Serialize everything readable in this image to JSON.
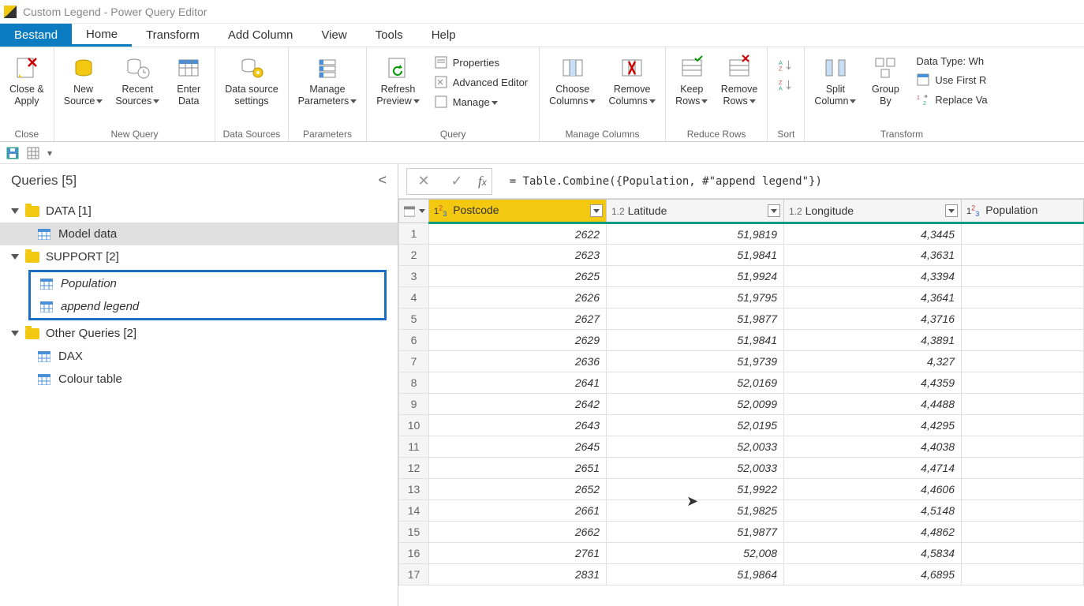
{
  "titlebar": {
    "text": "Custom Legend - Power Query Editor"
  },
  "menu": {
    "file": "Bestand",
    "home": "Home",
    "transform": "Transform",
    "addcolumn": "Add Column",
    "view": "View",
    "tools": "Tools",
    "help": "Help"
  },
  "ribbon": {
    "close": {
      "closeapply": "Close &\nApply",
      "group": "Close"
    },
    "newquery": {
      "newsource": "New\nSource",
      "recentsources": "Recent\nSources",
      "enterdata": "Enter\nData",
      "group": "New Query"
    },
    "datasources": {
      "settings": "Data source\nsettings",
      "group": "Data Sources"
    },
    "parameters": {
      "manage": "Manage\nParameters",
      "group": "Parameters"
    },
    "query": {
      "refresh": "Refresh\nPreview",
      "properties": "Properties",
      "advanced": "Advanced Editor",
      "manage": "Manage",
      "group": "Query"
    },
    "managecols": {
      "choose": "Choose\nColumns",
      "remove": "Remove\nColumns",
      "group": "Manage Columns"
    },
    "reducerows": {
      "keep": "Keep\nRows",
      "remove": "Remove\nRows",
      "group": "Reduce Rows"
    },
    "sort": {
      "group": "Sort"
    },
    "transform": {
      "split": "Split\nColumn",
      "groupby": "Group\nBy",
      "datatype": "Data Type: Wh",
      "firstrow": "Use First R",
      "replace": "Replace Va",
      "group": "Transform"
    }
  },
  "queries": {
    "header": "Queries [5]",
    "folders": {
      "data": {
        "label": "DATA [1]",
        "items": [
          {
            "label": "Model data"
          }
        ]
      },
      "support": {
        "label": "SUPPORT [2]",
        "items": [
          {
            "label": "Population"
          },
          {
            "label": "append legend"
          }
        ]
      },
      "other": {
        "label": "Other Queries [2]",
        "items": [
          {
            "label": "DAX"
          },
          {
            "label": "Colour table"
          }
        ]
      }
    }
  },
  "formula": {
    "text": "= Table.Combine({Population, #\"append legend\"})"
  },
  "columns": {
    "postcode": "Postcode",
    "latitude": "Latitude",
    "longitude": "Longitude",
    "population": "Population"
  },
  "rows": [
    {
      "n": "1",
      "postcode": "2622",
      "lat": "51,9819",
      "lon": "4,3445"
    },
    {
      "n": "2",
      "postcode": "2623",
      "lat": "51,9841",
      "lon": "4,3631"
    },
    {
      "n": "3",
      "postcode": "2625",
      "lat": "51,9924",
      "lon": "4,3394"
    },
    {
      "n": "4",
      "postcode": "2626",
      "lat": "51,9795",
      "lon": "4,3641"
    },
    {
      "n": "5",
      "postcode": "2627",
      "lat": "51,9877",
      "lon": "4,3716"
    },
    {
      "n": "6",
      "postcode": "2629",
      "lat": "51,9841",
      "lon": "4,3891"
    },
    {
      "n": "7",
      "postcode": "2636",
      "lat": "51,9739",
      "lon": "4,327"
    },
    {
      "n": "8",
      "postcode": "2641",
      "lat": "52,0169",
      "lon": "4,4359"
    },
    {
      "n": "9",
      "postcode": "2642",
      "lat": "52,0099",
      "lon": "4,4488"
    },
    {
      "n": "10",
      "postcode": "2643",
      "lat": "52,0195",
      "lon": "4,4295"
    },
    {
      "n": "11",
      "postcode": "2645",
      "lat": "52,0033",
      "lon": "4,4038"
    },
    {
      "n": "12",
      "postcode": "2651",
      "lat": "52,0033",
      "lon": "4,4714"
    },
    {
      "n": "13",
      "postcode": "2652",
      "lat": "51,9922",
      "lon": "4,4606"
    },
    {
      "n": "14",
      "postcode": "2661",
      "lat": "51,9825",
      "lon": "4,5148"
    },
    {
      "n": "15",
      "postcode": "2662",
      "lat": "51,9877",
      "lon": "4,4862"
    },
    {
      "n": "16",
      "postcode": "2761",
      "lat": "52,008",
      "lon": "4,5834"
    },
    {
      "n": "17",
      "postcode": "2831",
      "lat": "51,9864",
      "lon": "4,6895"
    }
  ]
}
